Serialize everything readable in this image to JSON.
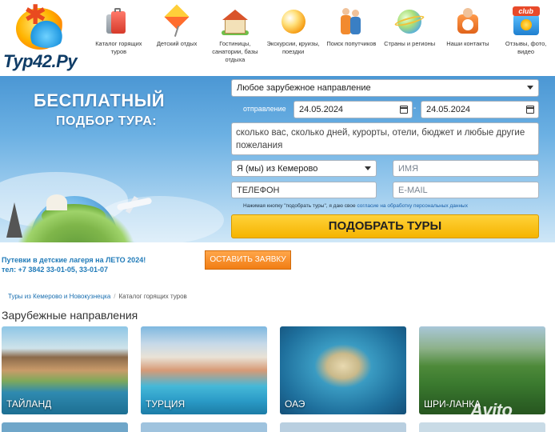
{
  "logo": {
    "text": "Тур42.Ру"
  },
  "nav": [
    {
      "label": "Каталог горящих туров",
      "icon": "suitcase-icon"
    },
    {
      "label": "Детский отдых",
      "icon": "kite-icon"
    },
    {
      "label": "Гостиницы, санатории, базы отдыха",
      "icon": "house-icon"
    },
    {
      "label": "Экскурсии, круизы, поездки",
      "icon": "ball-icon"
    },
    {
      "label": "Поиск попутчиков",
      "icon": "people-icon"
    },
    {
      "label": "Страны и регионы",
      "icon": "globe-icon"
    },
    {
      "label": "Наши контакты",
      "icon": "phone-icon"
    },
    {
      "label": "Отзывы, фото, видео",
      "icon": "club-icon",
      "badge": "club"
    }
  ],
  "hero": {
    "title_line1": "БЕСПЛАТНЫЙ",
    "title_line2": "ПОДБОР ТУРА:"
  },
  "form": {
    "direction": "Любое зарубежное направление",
    "departure_label": "отправление",
    "date_from": "24.05.2024",
    "date_separator": "-",
    "date_to": "24.05.2024",
    "wishes_placeholder": "сколько вас, сколько дней, курорты, отели, бюджет и любые другие пожелания",
    "city": "Я (мы) из Кемерово",
    "name_placeholder": "ИМЯ",
    "phone_placeholder": "ТЕЛЕФОН",
    "email_placeholder": "E-MAIL",
    "consent_text": "Нажимая кнопку \"подобрать туры\", я даю свое ",
    "consent_link": "согласие на обработку персональных данных",
    "submit_label": "ПОДОБРАТЬ ТУРЫ"
  },
  "promo": {
    "line1": "Путевки в детские лагеря на ЛЕТО 2024!",
    "line2": "тел: +7 3842 33-01-05, 33-01-07",
    "button_label": "ОСТАВИТЬ ЗАЯВКУ"
  },
  "breadcrumbs": [
    "Туры из Кемерово и Новокузнецка",
    "Каталог горящих туров"
  ],
  "breadcrumb_separator": "/",
  "section_title": "Зарубежные направления",
  "destinations": [
    {
      "label": "ТАЙЛАНД"
    },
    {
      "label": "ТУРЦИЯ"
    },
    {
      "label": "ОАЭ"
    },
    {
      "label": "ШРИ-ЛАНКА"
    }
  ],
  "watermark": "Avito"
}
